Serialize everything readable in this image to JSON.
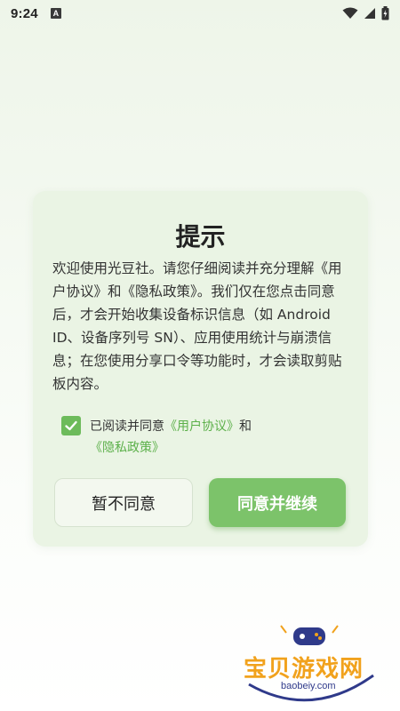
{
  "status_bar": {
    "time": "9:24",
    "notification_icon": "A"
  },
  "dialog": {
    "title": "提示",
    "body": "欢迎使用光豆社。请您仔细阅读并充分理解《用户协议》和《隐私政策》。我们仅在您点击同意后，才会开始收集设备标识信息（如 Android ID、设备序列号 SN）、应用使用统计与崩溃信息；在您使用分享口令等功能时，才会读取剪贴板内容。",
    "agree_prefix": "已阅读并同意",
    "user_agreement_link": "《用户协议》",
    "and_text": "和",
    "privacy_policy_link": "《隐私政策》",
    "checkbox_checked": true,
    "decline_button": "暂不同意",
    "accept_button": "同意并继续"
  },
  "watermark": {
    "name": "宝贝游戏网",
    "url": "baobeiy.com"
  },
  "colors": {
    "accent": "#7cc36a",
    "link": "#5cb04a",
    "dialog_bg": "#eaf4e4"
  }
}
